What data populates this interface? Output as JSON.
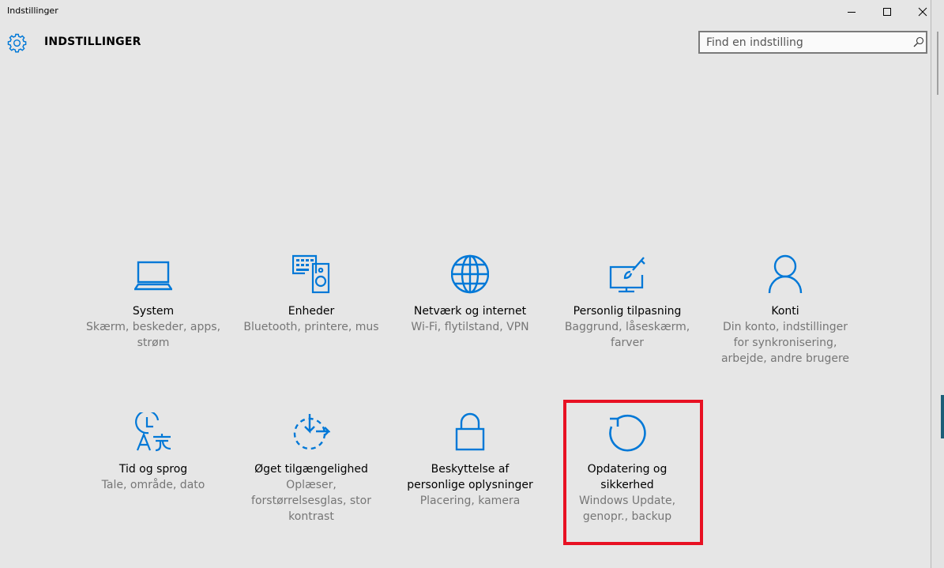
{
  "window": {
    "title": "Indstillinger",
    "controls": {
      "minimize": "minimize-icon",
      "maximize": "maximize-icon",
      "close": "close-icon"
    }
  },
  "header": {
    "title": "INDSTILLINGER",
    "icon": "gear-icon",
    "accent_color": "#0078d7"
  },
  "search": {
    "placeholder": "Find en indstilling",
    "value": "",
    "icon": "search-icon"
  },
  "tiles": [
    {
      "id": "system",
      "icon": "laptop-icon",
      "title": "System",
      "desc_lines": [
        "Skærm, beskeder, apps,",
        "strøm"
      ]
    },
    {
      "id": "devices",
      "icon": "devices-icon",
      "title": "Enheder",
      "desc_lines": [
        "Bluetooth, printere, mus"
      ]
    },
    {
      "id": "network",
      "icon": "globe-icon",
      "title": "Netværk og internet",
      "desc_lines": [
        "Wi-Fi, flytilstand, VPN"
      ]
    },
    {
      "id": "personalization",
      "icon": "personalization-icon",
      "title": "Personlig tilpasning",
      "desc_lines": [
        "Baggrund, låseskærm,",
        "farver"
      ]
    },
    {
      "id": "accounts",
      "icon": "person-icon",
      "title": "Konti",
      "desc_lines": [
        "Din konto, indstillinger",
        "for synkronisering,",
        "arbejde, andre brugere"
      ]
    },
    {
      "id": "time-language",
      "icon": "time-language-icon",
      "title": "Tid og sprog",
      "desc_lines": [
        "Tale, område, dato"
      ]
    },
    {
      "id": "ease-of-access",
      "icon": "ease-of-access-icon",
      "title": "Øget tilgængelighed",
      "desc_lines": [
        "Oplæser,",
        "forstørrelsesglas, stor",
        "kontrast"
      ]
    },
    {
      "id": "privacy",
      "icon": "lock-icon",
      "title_lines": [
        "Beskyttelse af",
        "personlige oplysninger"
      ],
      "desc_lines": [
        "Placering, kamera"
      ]
    },
    {
      "id": "update-security",
      "icon": "refresh-icon",
      "title_lines": [
        "Opdatering og",
        "sikkerhed"
      ],
      "desc_lines": [
        "Windows Update,",
        "genopr., backup"
      ],
      "highlighted": true,
      "highlight_color": "#e81123"
    }
  ]
}
